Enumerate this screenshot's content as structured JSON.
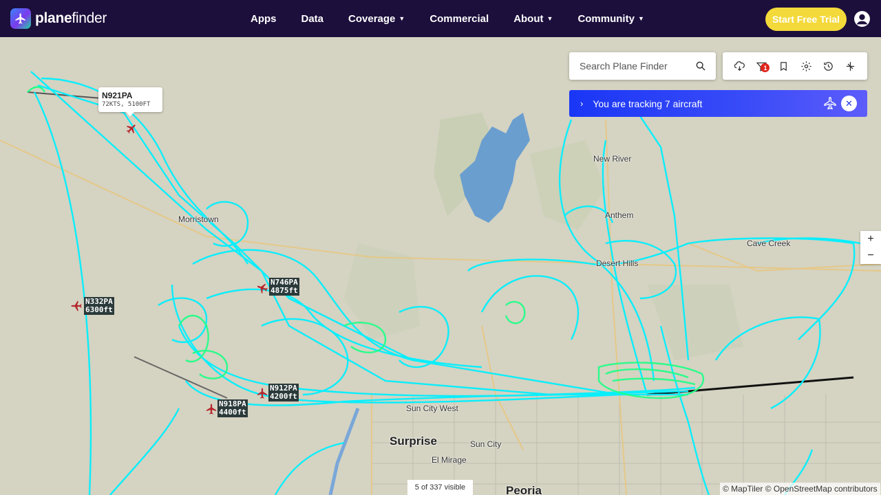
{
  "nav": {
    "logo_text_bold": "plane",
    "logo_text": "finder",
    "links": [
      {
        "label": "Apps",
        "dropdown": false
      },
      {
        "label": "Data",
        "dropdown": false
      },
      {
        "label": "Coverage",
        "dropdown": true
      },
      {
        "label": "Commercial",
        "dropdown": false
      },
      {
        "label": "About",
        "dropdown": true
      },
      {
        "label": "Community",
        "dropdown": true
      }
    ],
    "cta": "Start Free Trial",
    "user_icon": "user-circle-icon"
  },
  "search": {
    "placeholder": "Search Plane Finder",
    "value": "",
    "icon": "search-icon"
  },
  "toolbar": {
    "tools": [
      "weather-icon",
      "filter-icon",
      "bookmark-icon",
      "settings-icon",
      "history-icon",
      "airport-icon"
    ],
    "filter_badge": "1"
  },
  "tracking": {
    "text": "You are tracking 7 aircraft"
  },
  "zoom": {
    "in": "+",
    "out": "−"
  },
  "popup": {
    "callsign": "N921PA",
    "info": "72KTS, 5100FT"
  },
  "aircraft": [
    {
      "callsign": "N746PA",
      "alt": "4875ft"
    },
    {
      "callsign": "N332PA",
      "alt": "6300ft"
    },
    {
      "callsign": "N912PA",
      "alt": "4200ft"
    },
    {
      "callsign": "N918PA",
      "alt": "4400ft"
    }
  ],
  "places": {
    "new_river": "New River",
    "anthem": "Anthem",
    "desert_hills": "Desert Hills",
    "cave_creek": "Cave Creek",
    "morristown": "Morristown",
    "surprise": "Surprise",
    "sun_city": "Sun City",
    "el_mirage": "El Mirage",
    "peoria": "Peoria",
    "sun_city_west": "Sun City West"
  },
  "status": {
    "visible": "5 of 337 visible"
  },
  "attribution": "© MapTiler © OpenStreetMap contributors",
  "colors": {
    "nav_bg": "#1c0f3c",
    "cta": "#f3d93a",
    "track": "#00f0ff",
    "track_low": "#22ff88",
    "tracking_bar": "#1a36f6",
    "lake": "#6a9ecf"
  }
}
